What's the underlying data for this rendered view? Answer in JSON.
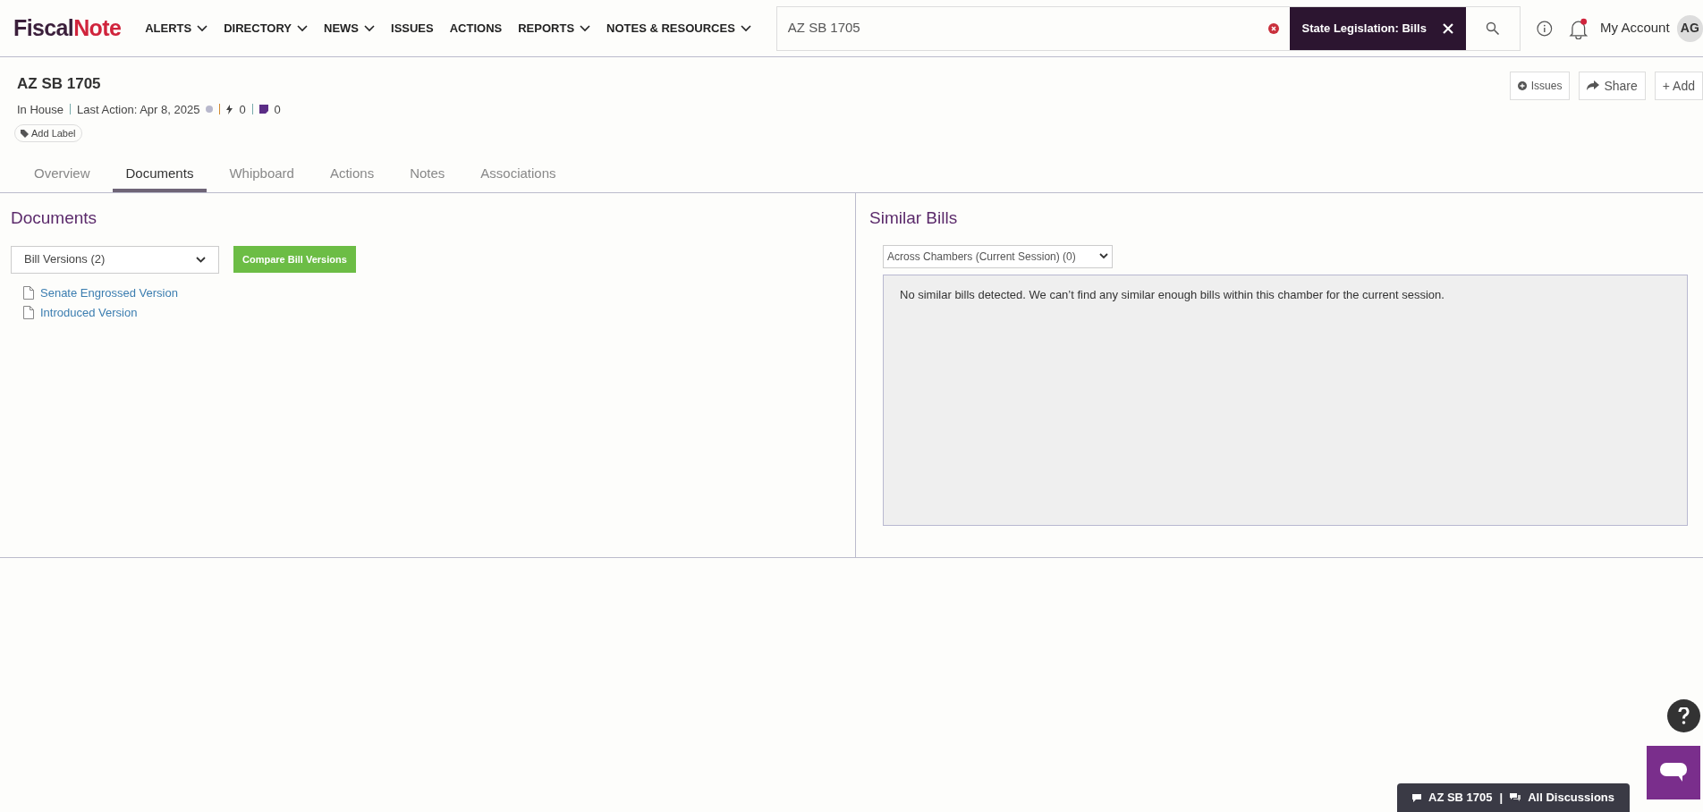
{
  "header": {
    "logo": {
      "part_1": "Fiscal",
      "part_2": "Note"
    },
    "nav": [
      {
        "label": "ALERTS",
        "dropdown": true
      },
      {
        "label": "DIRECTORY",
        "dropdown": true
      },
      {
        "label": "NEWS",
        "dropdown": true
      },
      {
        "label": "ISSUES",
        "dropdown": false
      },
      {
        "label": "ACTIONS",
        "dropdown": false
      },
      {
        "label": "REPORTS",
        "dropdown": true
      },
      {
        "label": "NOTES & RESOURCES",
        "dropdown": true
      }
    ],
    "search": {
      "value": "AZ SB 1705",
      "filter_tag": "State Legislation: Bills"
    },
    "notifications_unread": true,
    "account": "My Account",
    "avatar": "AG"
  },
  "bill": {
    "title": "AZ SB 1705",
    "status": "In House",
    "last_action": "Last Action: Apr 8, 2025",
    "actions_count": "0",
    "notes_count": "0",
    "add_label": "Add Label",
    "buttons": [
      {
        "kind": "issues",
        "label": "Issues"
      },
      {
        "kind": "share",
        "label": "Share"
      },
      {
        "kind": "add",
        "label": "+ Add"
      }
    ]
  },
  "tabs": [
    {
      "label": "Overview",
      "selected": false
    },
    {
      "label": "Documents",
      "selected": true
    },
    {
      "label": "Whipboard",
      "selected": false
    },
    {
      "label": "Actions",
      "selected": false
    },
    {
      "label": "Notes",
      "selected": false
    },
    {
      "label": "Associations",
      "selected": false
    }
  ],
  "documents": {
    "heading": "Documents",
    "select": "Bill Versions (2)",
    "compare_button": "Compare Bill Versions",
    "links": [
      "Senate Engrossed Version",
      "Introduced Version"
    ]
  },
  "similar_bills": {
    "heading": "Similar Bills",
    "select": "Across Chambers (Current Session) (0)",
    "message": "No similar bills detected. We can’t find any similar enough bills within this chamber for the current session."
  },
  "discussion_bar": {
    "bill": "AZ SB 1705",
    "separator": "|",
    "all": "All Discussions"
  }
}
